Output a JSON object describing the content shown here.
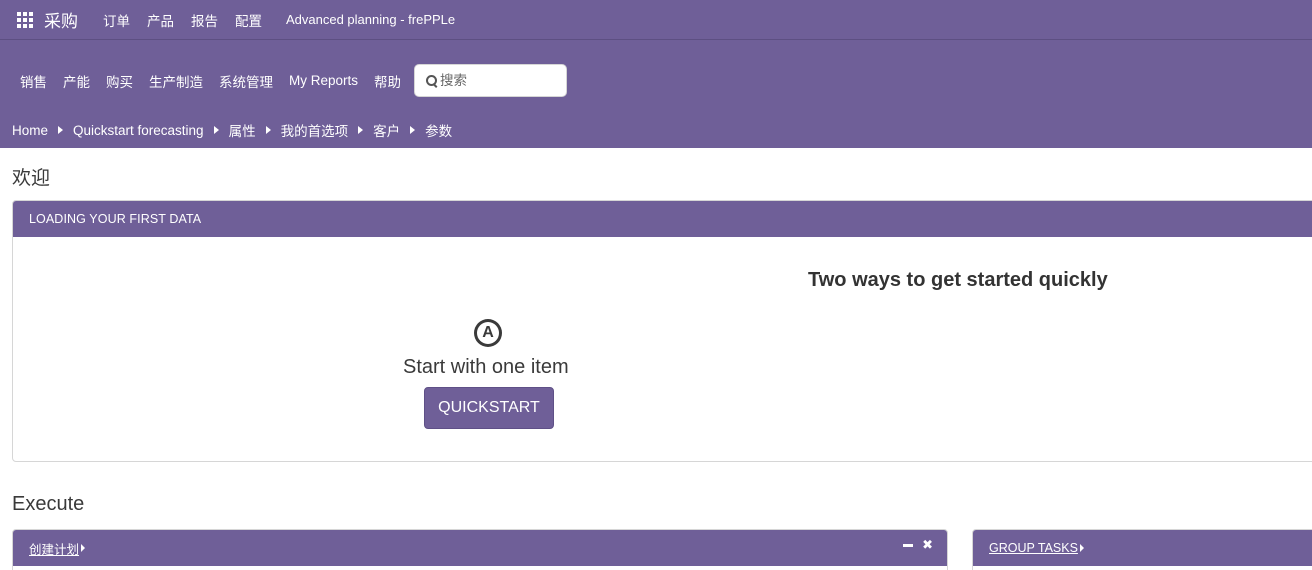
{
  "topbar": {
    "app_name": "采购",
    "menus": [
      "订单",
      "产品",
      "报告",
      "配置"
    ],
    "title": "Advanced planning - frePPLe"
  },
  "navbar": {
    "items": [
      "销售",
      "产能",
      "购买",
      "生产制造",
      "系统管理",
      "My Reports",
      "帮助"
    ],
    "search_placeholder": "搜索"
  },
  "breadcrumb": [
    "Home",
    "Quickstart forecasting",
    "属性",
    "我的首选项",
    "客户",
    "参数"
  ],
  "welcome": {
    "title": "欢迎",
    "panel_title": "LOADING YOUR FIRST DATA",
    "ways_title": "Two ways to get started quickly",
    "option_a_badge": "A",
    "option_a_text": "Start with one item",
    "option_a_button": "QUICKSTART"
  },
  "execute": {
    "title": "Execute",
    "widgets": [
      {
        "label": "创建计划"
      },
      {
        "label": "GROUP TASKS"
      }
    ]
  },
  "colors": {
    "brand_purple": "#6f5f98"
  }
}
